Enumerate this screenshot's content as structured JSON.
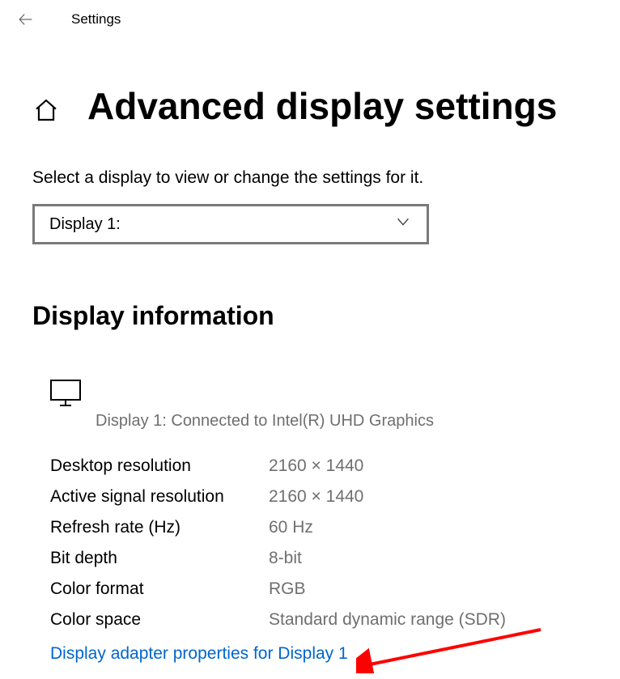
{
  "header": {
    "title": "Settings"
  },
  "page": {
    "title": "Advanced display settings",
    "instruction": "Select a display to view or change the settings for it."
  },
  "dropdown": {
    "selected": "Display 1:"
  },
  "section": {
    "title": "Display information"
  },
  "display": {
    "caption": "Display 1: Connected to Intel(R) UHD Graphics"
  },
  "info": [
    {
      "label": "Desktop resolution",
      "value": "2160 × 1440"
    },
    {
      "label": "Active signal resolution",
      "value": "2160 × 1440"
    },
    {
      "label": "Refresh rate (Hz)",
      "value": "60 Hz"
    },
    {
      "label": "Bit depth",
      "value": "8-bit"
    },
    {
      "label": "Color format",
      "value": "RGB"
    },
    {
      "label": "Color space",
      "value": "Standard dynamic range (SDR)"
    }
  ],
  "link": {
    "text": "Display adapter properties for Display 1"
  }
}
